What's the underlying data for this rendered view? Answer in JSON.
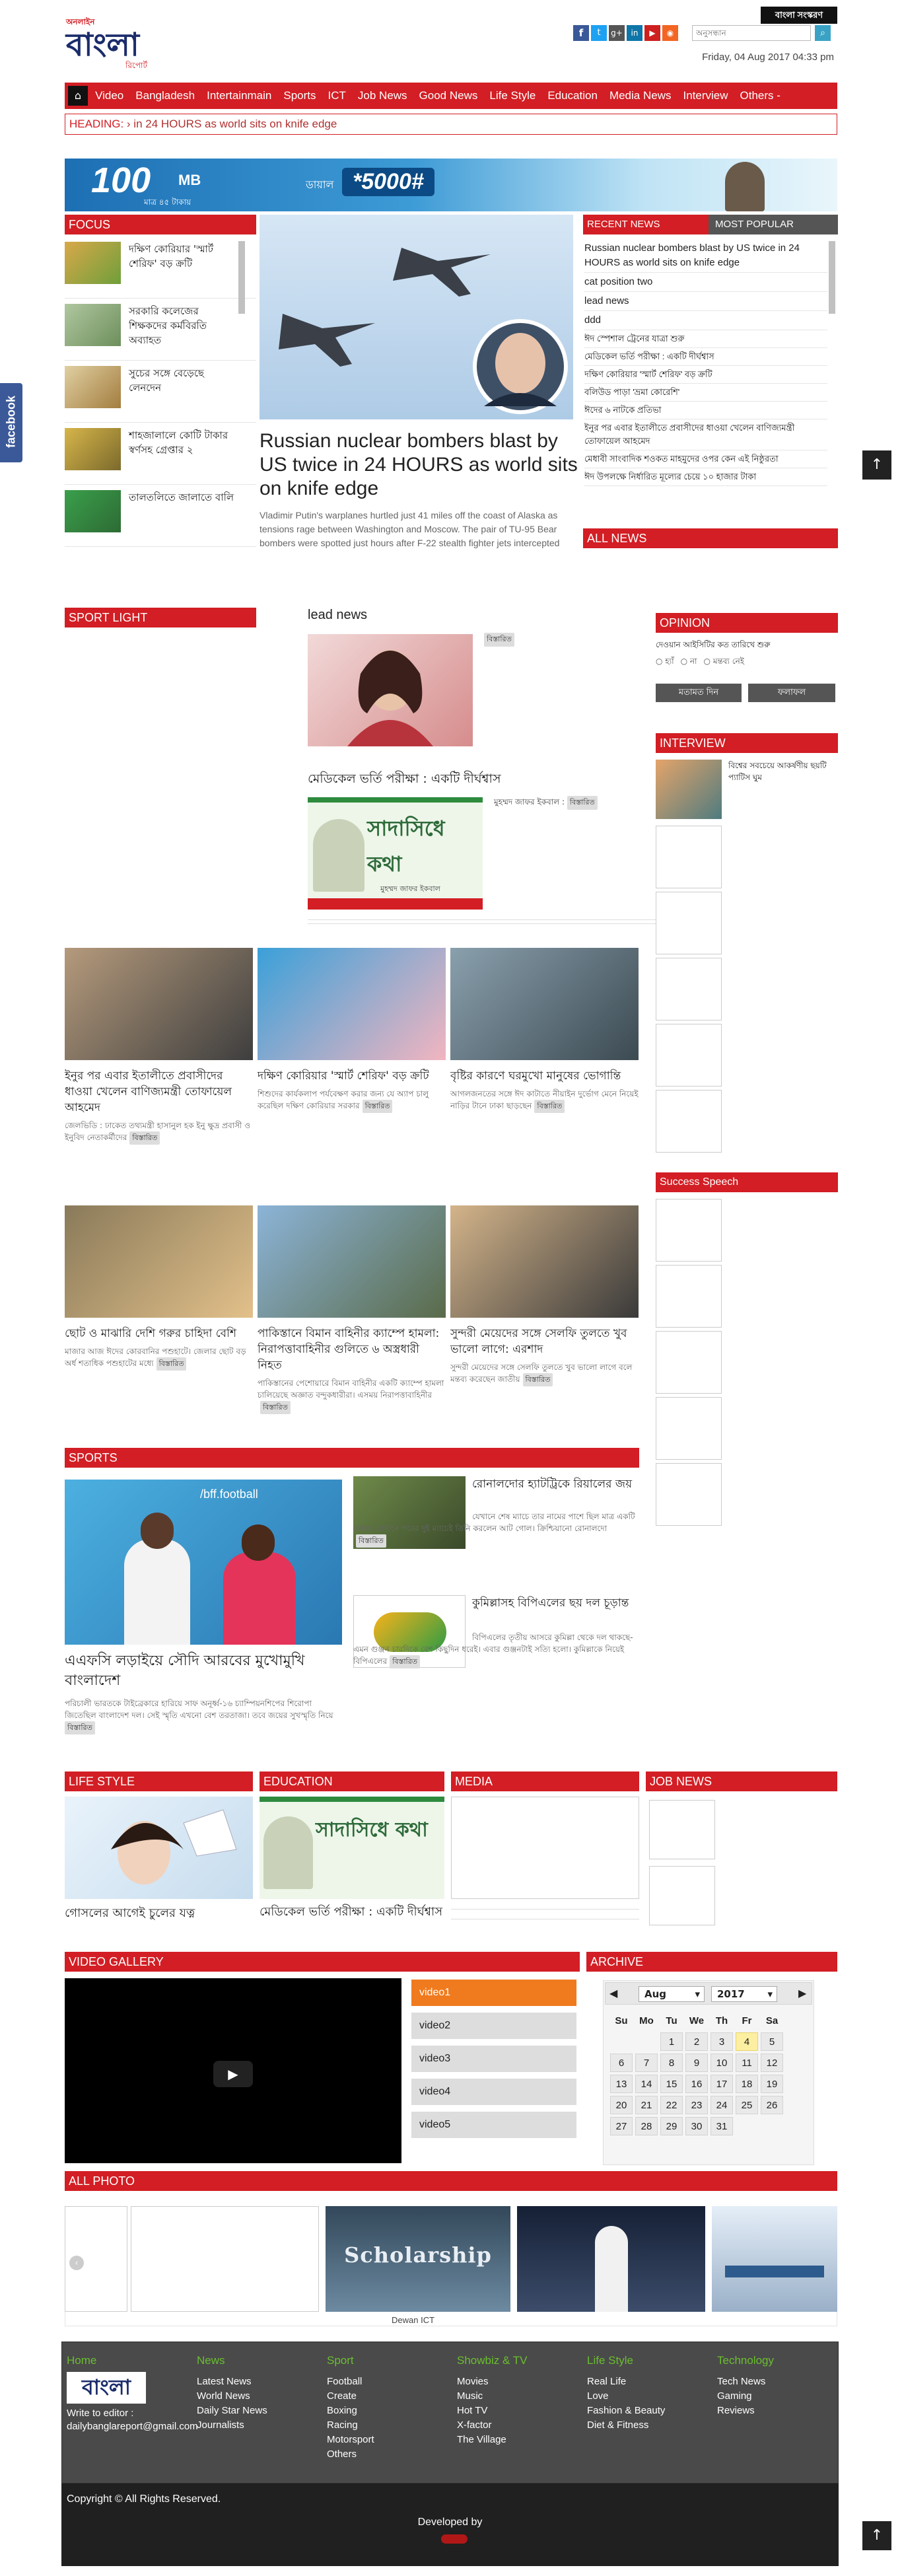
{
  "brand": {
    "logo_top": "অনলাইন",
    "logo_main": "বাংলা",
    "logo_sub": "রিপোর্ট",
    "footer_logo": "বাংলা"
  },
  "header": {
    "lang_button": "বাংলা সংস্করণ",
    "search_placeholder": "অনুসন্ধান",
    "date": "Friday, 04 Aug 2017 04:33 pm"
  },
  "nav": [
    "Video",
    "Bangladesh",
    "Intertainmain",
    "Sports",
    "ICT",
    "Job News",
    "Good News",
    "Life Style",
    "Education",
    "Media News",
    "Interview",
    "Others -"
  ],
  "ticker": {
    "label": "HEADING:",
    "text": "› in 24 HOURS as world sits on knife edge"
  },
  "ad": {
    "big": "100",
    "unit": "MB",
    "sub": "মাত্র ৪৫ টাকায়",
    "dial": "ডায়াল",
    "code": "*5000#"
  },
  "focus": {
    "title": "FOCUS",
    "items": [
      "দক্ষিণ কোরিয়ার 'স্মার্ট শেরিফ' বড় ক্রটি",
      "সরকারি কলেজের শিক্ষকদের কর্মবিরতি অব্যাহত",
      "সুচের সঙ্গে বেড়েছে লেনদেন",
      "শাহজালালে কোটি টাকার স্বর্ণসহ গ্রেপ্তার ২",
      "তালতলিতে জালাতে বালি"
    ]
  },
  "lead": {
    "title": "Russian nuclear bombers blast by US twice in 24 HOURS as world sits on knife edge",
    "summary": "Vladimir Putin's warplanes hurtled just 41 miles off the coast of Alaska as tensions rage between Washington and Moscow. The pair of TU-95 Bear bombers were spotted just hours after F-22 stealth fighter jets intercepted"
  },
  "recent": {
    "tab_recent": "RECENT NEWS",
    "tab_popular": "MOST POPULAR",
    "items": [
      "Russian nuclear bombers blast by US twice in 24 HOURS as world sits on knife edge",
      "cat position two",
      "lead news",
      "ddd",
      "ঈদ স্পেশাল ট্রেনের যাত্রা শুরু",
      "মেডিকেল ভর্তি পরীক্ষা : একটি দীর্ঘশ্বাস",
      "দক্ষিণ কোরিয়ার 'স্মার্ট শেরিফ' বড় ক্রটি",
      "বলিউড পাড়া 'ভ্রমা কোরেশি'",
      "ঈদের ৬ নাটকে প্রতিভা",
      "ইনুর পর এবার ইতালীতে প্রবাসীদের ধাওয়া খেলেন বাণিজ্যমন্ত্রী তোফায়েল আহমেদ",
      "মেধাবী সাংবাদিক শওকত মাহমুদের ওপর কেন এই নিষ্ঠুরতা",
      "ঈদ উপলক্ষে নির্ধারিত মূল্যের চেয়ে ১০ হাজার টাকা"
    ],
    "all": "ALL NEWS"
  },
  "sport_light": {
    "title": "SPORT LIGHT"
  },
  "lead_news": {
    "title": "lead news",
    "tag": "বিস্তারিত",
    "story_title": "মেডিকেল ভর্তি পরীক্ষা : একটি দীর্ঘশ্বাস",
    "byline": "মুহম্মদ জাফর ইকবাল :",
    "story_tag": "বিস্তারিত",
    "banner": "সাদাসিধে কথা",
    "banner_sub": "মুহম্মদ জাফর ইকবাল"
  },
  "opinion": {
    "title": "OPINION",
    "question": "দেওয়ান আইসিটির কত তারিখে শুরু",
    "options": [
      "হ্যাঁ",
      "না",
      "মন্তব্য নেই"
    ],
    "vote": "মতামত দিন",
    "result": "ফলাফল"
  },
  "interview": {
    "title": "INTERVIEW",
    "item": "বিশ্বের সবচেয়ে আকর্ষণীয় ছয়টি প্যাটিস ঘুম"
  },
  "success": {
    "title": "Success Speech"
  },
  "grid": [
    {
      "title": "ইনুর পর এবার ইতালীতে প্রবাসীদের ধাওয়া খেলেন বাণিজ্যমন্ত্রী তোফায়েল আহমেদ",
      "text": "জেলভিডি : ঢাকেত তথ্যমন্ত্রী হাসানুল হক ইনু ক্ষুদ্র প্রবাসী ও ইনুবিদ নেতাকর্মীদের",
      "tag": "বিস্তারিত"
    },
    {
      "title": "দক্ষিণ কোরিয়ার 'স্মার্ট শেরিফ' বড় ক্রটি",
      "text": "শিশুদের কার্যকলাপ পর্যবেক্ষণ করার জন্য যে অ্যাপ চালু করেছিল দক্ষিণ কোরিয়ার সরকার",
      "tag": "বিস্তারিত"
    },
    {
      "title": "বৃষ্টির কারণে ঘরমুখো মানুষের ভোগান্তি",
      "text": "আগলজনতের সঙ্গে ঈদ কাটাতে নীয়াইন দুর্ভোগ মেনে নিয়েই নাড়ির টানে ঢাকা ছাড়ছেন",
      "tag": "বিস্তারিত"
    },
    {
      "title": "ছোট ও মাঝারি দেশি গরুর চাহিদা বেশি",
      "text": "মাজার আজ ঈদের কোরবানির পশুহাটে। জেলার ছোট বড় অর্ধ শতাধিক পশুহাটের মধ্যে",
      "tag": "বিস্তারিত"
    },
    {
      "title": "পাকিস্তানে বিমান বাহিনীর ক্যাম্পে হামলা: নিরাপত্তাবাহিনীর গুলিতে ৬ অস্ত্রধারী নিহত",
      "text": "পাকিস্তানের পেশোয়ারে বিমান বাহিনীর একটি ক্যাম্পে হামলা চালিয়েছে অজ্ঞাত বন্দুকধারীরা। এসময় নিরাপত্তাবাহিনীর",
      "tag": "বিস্তারিত"
    },
    {
      "title": "সুন্দরী মেয়েদের সঙ্গে সেলফি তুলতে খুব ভালো লাগে: এরশাদ",
      "text": "সুন্দরী মেয়েদের সঙ্গে সেলফি তুলতে খুব ভালো লাগে বলে মন্তব্য করেছেন জাতীয়",
      "tag": "বিস্তারিত"
    }
  ],
  "sports": {
    "title": "SPORTS",
    "lead_title": "এএফসি লড়াইয়ে সৌদি আরবের মুখোমুখি বাংলাদেশ",
    "lead_text": "পরিচালী ভারতকে টাইব্রেকারে হারিয়ে সাফ অনূর্ধ্ব-১৬ চ্যাম্পিয়নশিপের শিরোপা জিতেছিল বাংলাদেশ দল। সেই স্মৃতি এখনো বেশ তরতাজা। তবে জয়ের সুখস্মৃতি নিয়ে",
    "lead_tag": "বিস্তারিত",
    "img_caption": "/bff.football",
    "items": [
      {
        "title": "রোনালদোর হ্যাটট্রিকে রিয়ালের জয়",
        "text": "যেখানে শেষ ম্যাচে তার নামের পাশে ছিল মাত্র একটি গোল। সেখানে পরের দুই ম্যাচেই তিনি করলেন আট গোল। ক্রিশ্চিয়ানো রোনালদো",
        "tag": "বিস্তারিত"
      },
      {
        "title": "কুমিল্লাসহ বিপিএলের ছয় দল চূড়ান্ত",
        "text": "বিপিএলের তৃতীয় আসরে কুমিল্লা থেকে দল থাকছে- এমন গুঞ্জন চারদিকে বেশ কিছুদিন ধরেই। এবার গুঞ্জনটাই সত্যি হলো। কুমিল্লাকে নিয়েই বিপিএলের",
        "tag": "বিস্তারিত"
      }
    ]
  },
  "life": {
    "title": "LIFE STYLE",
    "item": "গোসলের আগেই চুলের যত্ন"
  },
  "education": {
    "title": "EDUCATION",
    "item": "মেডিকেল ভর্তি পরীক্ষা : একটি দীর্ঘশ্বাস",
    "banner": "সাদাসিধে কথা"
  },
  "media": {
    "title": "MEDIA"
  },
  "jobs": {
    "title": "JOB NEWS"
  },
  "video": {
    "title": "VIDEO GALLERY",
    "items": [
      "video1",
      "video2",
      "video3",
      "video4",
      "video5"
    ]
  },
  "archive": {
    "title": "ARCHIVE",
    "month": "Aug",
    "year": "2017",
    "days": [
      "Su",
      "Mo",
      "Tu",
      "We",
      "Th",
      "Fr",
      "Sa"
    ],
    "weeks": [
      [
        "",
        "",
        "1",
        "2",
        "3",
        "4",
        "5"
      ],
      [
        "6",
        "7",
        "8",
        "9",
        "10",
        "11",
        "12"
      ],
      [
        "13",
        "14",
        "15",
        "16",
        "17",
        "18",
        "19"
      ],
      [
        "20",
        "21",
        "22",
        "23",
        "24",
        "25",
        "26"
      ],
      [
        "27",
        "28",
        "29",
        "30",
        "31",
        "",
        ""
      ]
    ]
  },
  "photos": {
    "title": "ALL PHOTO",
    "scholarship": "Scholarship",
    "caption": "Dewan ICT"
  },
  "footer": {
    "cols": [
      {
        "head": "Home",
        "links": []
      },
      {
        "head": "News",
        "links": [
          "Latest News",
          "World News",
          "Daily Star News",
          "Journalists"
        ]
      },
      {
        "head": "Sport",
        "links": [
          "Football",
          "Create",
          "Boxing",
          "Racing",
          "Motorsport",
          "Others"
        ]
      },
      {
        "head": "Showbiz & TV",
        "links": [
          "Movies",
          "Music",
          "Hot TV",
          "X-factor",
          "The Village"
        ]
      },
      {
        "head": "Life Style",
        "links": [
          "Real Life",
          "Love",
          "Fashion & Beauty",
          "Diet & Fitness"
        ]
      },
      {
        "head": "Technology",
        "links": [
          "Tech News",
          "Gaming",
          "Reviews"
        ]
      }
    ],
    "editor_label": "Write to editor :",
    "editor_email": "dailybanglareport@gmail.com",
    "copyright": "Copyright © All Rights Reserved.",
    "developed": "Developed by"
  },
  "social": {
    "facebook_tab": "facebook"
  },
  "colors": {
    "accent": "#d21e24",
    "footer": "#4a4a4a",
    "nav_active": "#f07a1e"
  }
}
